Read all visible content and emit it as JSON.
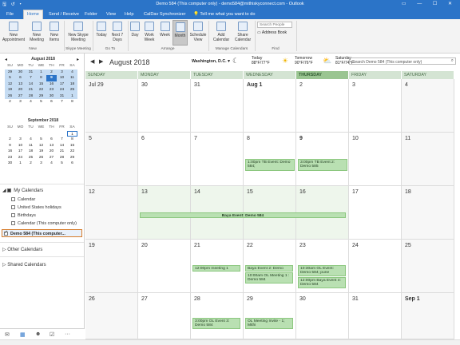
{
  "window": {
    "title": "Demo 584 (This computer only) - demo584@mithiskyconnect.com - Outlook",
    "controls": [
      "restore-icon",
      "minimize-icon",
      "maximize-icon",
      "close-icon"
    ]
  },
  "tabs": [
    {
      "label": "File"
    },
    {
      "label": "Home"
    },
    {
      "label": "Send / Receive"
    },
    {
      "label": "Folder"
    },
    {
      "label": "View"
    },
    {
      "label": "Help"
    },
    {
      "label": "CalDav Synchronizer"
    }
  ],
  "tell_me": "Tell me what you want to do",
  "ribbon": {
    "new_appointment": "New Appointment",
    "new_meeting": "New Meeting",
    "new_items": "New Items",
    "new_skype": "New Skype Meeting",
    "today": "Today",
    "next7": "Next 7 Days",
    "day": "Day",
    "work_week": "Work Week",
    "week": "Week",
    "month": "Month",
    "schedule_view": "Schedule View",
    "add_calendar": "Add Calendar",
    "share_calendar": "Share Calendar",
    "search_people": "Search People",
    "address_book": "Address Book",
    "groups": {
      "new": "New",
      "skype": "Skype Meeting",
      "goto": "Go To",
      "arrange": "Arrange",
      "manage": "Manage Calendars",
      "find": "Find"
    }
  },
  "mini_cal_aug": {
    "title": "August 2018",
    "headers": [
      "SU",
      "MO",
      "TU",
      "WE",
      "TH",
      "FR",
      "SA"
    ],
    "days": [
      "29",
      "30",
      "31",
      "1",
      "2",
      "3",
      "4",
      "5",
      "6",
      "7",
      "8",
      "9",
      "10",
      "11",
      "12",
      "13",
      "14",
      "15",
      "16",
      "17",
      "18",
      "19",
      "20",
      "21",
      "22",
      "23",
      "24",
      "25",
      "26",
      "27",
      "28",
      "29",
      "30",
      "31",
      "1",
      "2",
      "3",
      "4",
      "5",
      "6",
      "7",
      "8"
    ]
  },
  "mini_cal_sep": {
    "title": "September 2018",
    "headers": [
      "SU",
      "MO",
      "TU",
      "WE",
      "TH",
      "FR",
      "SA"
    ],
    "days": [
      "",
      "",
      "",
      "",
      "",
      "",
      "1",
      "2",
      "3",
      "4",
      "5",
      "6",
      "7",
      "8",
      "9",
      "10",
      "11",
      "12",
      "13",
      "14",
      "15",
      "16",
      "17",
      "18",
      "19",
      "20",
      "21",
      "22",
      "23",
      "24",
      "25",
      "26",
      "27",
      "28",
      "29",
      "30",
      "1",
      "2",
      "3",
      "4",
      "5",
      "6"
    ]
  },
  "folders": {
    "my_calendars": "My Calendars",
    "calendar": "Calendar",
    "us_holidays": "United States holidays",
    "birthdays": "Birthdays",
    "calendar_local": "Calendar (This computer only)",
    "demo_selected": "Demo 584 (This computer...",
    "other": "Other Calendars",
    "shared": "Shared Calendars"
  },
  "bottom_nav": [
    "mail-icon",
    "calendar-icon",
    "people-icon",
    "tasks-icon",
    "more-icon"
  ],
  "cal": {
    "month": "August 2018",
    "location": "Washington, D.C.",
    "weather": [
      {
        "day": "Today",
        "temp": "88°F/77°F",
        "icon": "☾"
      },
      {
        "day": "Tomorrow",
        "temp": "90°F/76°F",
        "icon": "☀"
      },
      {
        "day": "Saturday",
        "temp": "81°F/74°F",
        "icon": "⛅"
      }
    ],
    "search": "Search Demo 584 (This computer only)",
    "day_headers": [
      "SUNDAY",
      "MONDAY",
      "TUESDAY",
      "WEDNESDAY",
      "THURSDAY",
      "FRIDAY",
      "SATURDAY"
    ],
    "weeks": [
      [
        "Jul 29",
        "30",
        "31",
        "Aug 1",
        "2",
        "3",
        "4"
      ],
      [
        "5",
        "6",
        "7",
        "8",
        "9",
        "10",
        "11"
      ],
      [
        "12",
        "13",
        "14",
        "15",
        "16",
        "17",
        "18"
      ],
      [
        "19",
        "20",
        "21",
        "22",
        "23",
        "24",
        "25"
      ],
      [
        "26",
        "27",
        "28",
        "29",
        "30",
        "31",
        "Sep 1"
      ]
    ],
    "events": {
      "w1_wed": "1:00pm TB Event: Demo 584;",
      "w1_thu": "3:00pm TB Event 2: Demo 585",
      "w2_span": "Baya Event: Demo 584",
      "w3_tue": "12:00pm meeting 1",
      "w3_wed_a": "Baya Event 2: Demo 584",
      "w3_wed_b": "10:00am OL Meeting 1 : Demo 584",
      "w3_thu_a": "10:30am OL Event: Demo 584; pune",
      "w3_thu_b": "12:00pm Baya Event 4: Demo 584",
      "w4_tue": "3:00pm OL Event 3: Demo 584",
      "w4_wed": "OL Meeting Invite - 1; Mithi"
    }
  }
}
